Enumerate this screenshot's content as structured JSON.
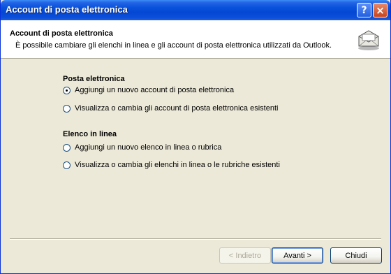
{
  "window": {
    "title": "Account di posta elettronica",
    "help_glyph": "?",
    "close_glyph": "×"
  },
  "header": {
    "title": "Account di posta elettronica",
    "subtitle": "È possibile cambiare gli elenchi in linea e gli account di posta elettronica utilizzati da Outlook.",
    "icon": "mail-accounts-icon"
  },
  "email_section": {
    "title": "Posta elettronica",
    "options": [
      {
        "label": "Aggiungi un nuovo account di posta elettronica",
        "selected": true
      },
      {
        "label": "Visualizza o cambia gli account di posta elettronica esistenti",
        "selected": false
      }
    ]
  },
  "directory_section": {
    "title": "Elenco in linea",
    "options": [
      {
        "label": "Aggiungi un nuovo elenco in linea o rubrica",
        "selected": false
      },
      {
        "label": "Visualizza o cambia gli elenchi in linea o le rubriche esistenti",
        "selected": false
      }
    ]
  },
  "buttons": {
    "back": "< Indietro",
    "next": "Avanti >",
    "close": "Chiudi"
  }
}
